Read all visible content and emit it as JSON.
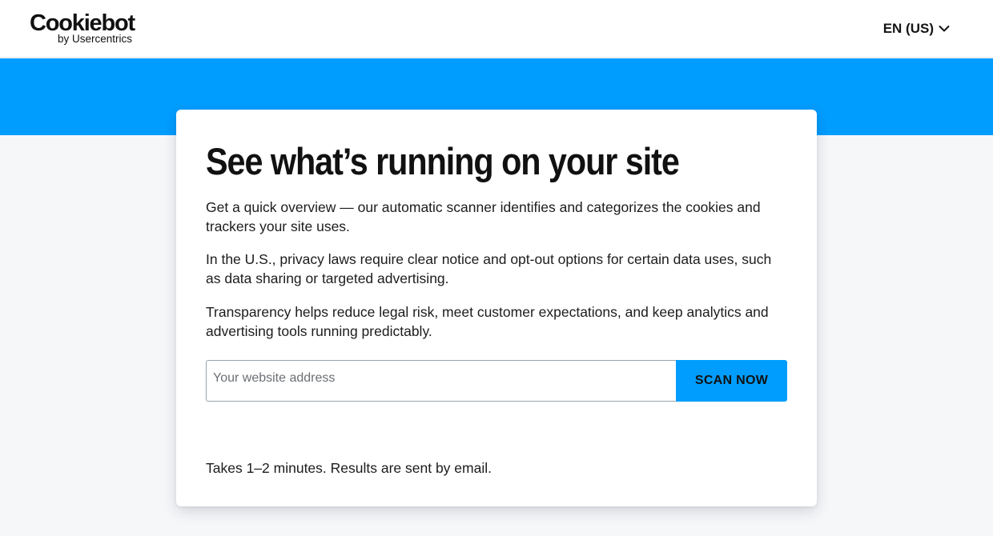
{
  "header": {
    "logo": {
      "name": "Cookiebot",
      "tagline": "by Usercentrics"
    },
    "language": {
      "label": "EN (US)",
      "icon": "chevron-down-icon"
    }
  },
  "hero": {
    "band_color": "#009dff"
  },
  "card": {
    "title": "See what’s running on your site",
    "paragraphs": [
      "Get a quick overview — our automatic scanner identifies and categorizes the cookies and trackers your site uses.",
      "In the U.S., privacy laws require clear notice and opt-out options for certain data uses, such as data sharing or targeted advertising.",
      "Transparency helps reduce legal risk, meet customer expectations, and keep analytics and advertising tools running predictably."
    ],
    "form": {
      "input_value": "",
      "input_placeholder": "Your website address",
      "button_label": "SCAN NOW"
    },
    "note": "Takes 1–2 minutes. Results are sent by email."
  },
  "colors": {
    "accent": "#009dff",
    "background": "#f6f7f9",
    "card": "#ffffff"
  }
}
